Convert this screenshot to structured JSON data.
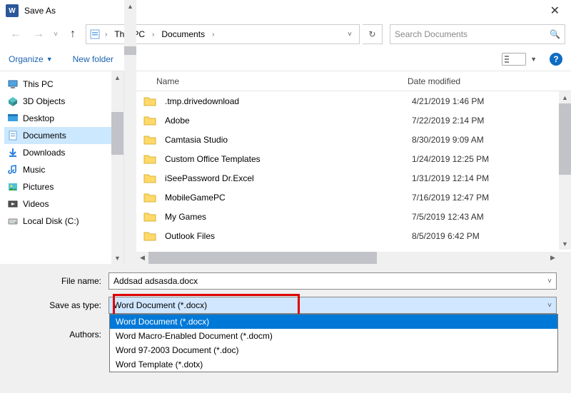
{
  "window": {
    "title": "Save As"
  },
  "breadcrumb": {
    "root": "This PC",
    "folder": "Documents"
  },
  "search": {
    "placeholder": "Search Documents"
  },
  "toolbar": {
    "organize": "Organize",
    "newfolder": "New folder"
  },
  "tree": {
    "items": [
      {
        "label": "This PC",
        "icon": "pc"
      },
      {
        "label": "3D Objects",
        "icon": "3d"
      },
      {
        "label": "Desktop",
        "icon": "desktop"
      },
      {
        "label": "Documents",
        "icon": "documents",
        "selected": true
      },
      {
        "label": "Downloads",
        "icon": "downloads"
      },
      {
        "label": "Music",
        "icon": "music"
      },
      {
        "label": "Pictures",
        "icon": "pictures"
      },
      {
        "label": "Videos",
        "icon": "videos"
      },
      {
        "label": "Local Disk (C:)",
        "icon": "disk"
      }
    ]
  },
  "files": {
    "headers": {
      "name": "Name",
      "date": "Date modified"
    },
    "rows": [
      {
        "name": ".tmp.drivedownload",
        "date": "4/21/2019 1:46 PM"
      },
      {
        "name": "Adobe",
        "date": "7/22/2019 2:14 PM"
      },
      {
        "name": "Camtasia Studio",
        "date": "8/30/2019 9:09 AM"
      },
      {
        "name": "Custom Office Templates",
        "date": "1/24/2019 12:25 PM"
      },
      {
        "name": "iSeePassword Dr.Excel",
        "date": "1/31/2019 12:14 PM"
      },
      {
        "name": "MobileGamePC",
        "date": "7/16/2019 12:47 PM"
      },
      {
        "name": "My Games",
        "date": "7/5/2019 12:43 AM"
      },
      {
        "name": "Outlook Files",
        "date": "8/5/2019 6:42 PM"
      }
    ]
  },
  "form": {
    "filename_label": "File name:",
    "filename_value": "Addsad adsasda.docx",
    "type_label": "Save as type:",
    "type_value": "Word Document (*.docx)",
    "authors_label": "Authors:",
    "type_options": [
      "Word Document (*.docx)",
      "Word Macro-Enabled Document (*.docm)",
      "Word 97-2003 Document (*.doc)",
      "Word Template (*.dotx)"
    ]
  }
}
